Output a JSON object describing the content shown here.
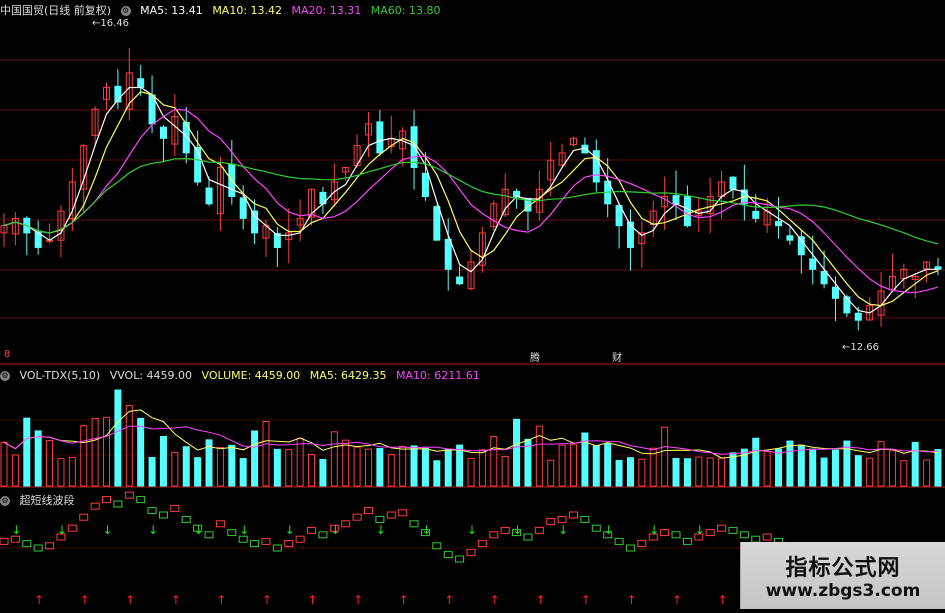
{
  "main_header": {
    "title": "中国国贸(日线 前复权)",
    "ma5": "MA5: 13.41",
    "ma10": "MA10: 13.42",
    "ma20": "MA20: 13.31",
    "ma60": "MA60: 13.80"
  },
  "vol_header": {
    "name": "VOL-TDX(5,10)",
    "vvol": "VVOL: 4459.00",
    "volume": "VOLUME: 4459.00",
    "ma5": "MA5: 6429.35",
    "ma10": "MA10: 6211.61"
  },
  "ind_header": {
    "name": "超短线波段"
  },
  "annotations": {
    "high": "16.46",
    "low": "12.66",
    "event1": "腾",
    "event2": "财",
    "left_marker": "8"
  },
  "watermark": {
    "title": "指标公式网",
    "url": "www.zbgs3.com"
  },
  "colors": {
    "up": "#ff3c3c",
    "down": "#54ffff",
    "ma5": "#ffffff",
    "ma10": "#ffff66",
    "ma20": "#ff44ff",
    "ma60": "#33cc33",
    "arrow_up": "#ff2020",
    "arrow_down": "#20e020"
  },
  "chart_data": {
    "type": "candlestick",
    "series_close": [
      14.0,
      14.1,
      13.9,
      13.7,
      13.8,
      14.2,
      14.6,
      15.1,
      15.6,
      15.9,
      15.7,
      16.1,
      15.9,
      15.4,
      15.2,
      15.5,
      15.0,
      14.6,
      14.3,
      14.8,
      14.4,
      14.1,
      13.9,
      14.0,
      13.7,
      13.9,
      14.1,
      14.5,
      14.3,
      14.6,
      14.8,
      15.1,
      15.4,
      15.0,
      15.2,
      15.3,
      14.8,
      14.4,
      13.8,
      13.4,
      13.2,
      13.5,
      13.9,
      14.3,
      14.5,
      14.4,
      14.2,
      14.5,
      14.9,
      15.0,
      15.2,
      15.0,
      14.6,
      14.3,
      14.0,
      13.7,
      13.9,
      14.2,
      14.4,
      14.3,
      14.0,
      14.2,
      14.4,
      14.6,
      14.5,
      14.3,
      14.1,
      14.2,
      14.0,
      13.8,
      13.6,
      13.4,
      13.2,
      13.0,
      12.8,
      12.7,
      12.9,
      13.1,
      13.3,
      13.4,
      13.3,
      13.5,
      13.4
    ]
  }
}
